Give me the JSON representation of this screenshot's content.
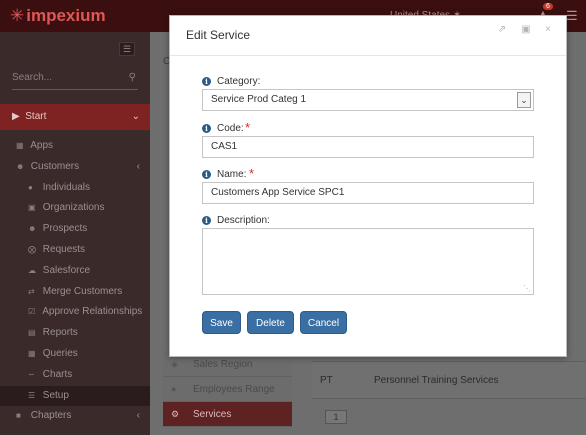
{
  "app": {
    "logo_text": "impexium",
    "logo_mark": "✳",
    "country": "United States ✶",
    "notification_count": "6"
  },
  "sidebar": {
    "search_placeholder": "Search...",
    "start_label": "Start",
    "items": [
      {
        "label": "Apps",
        "icon": "grid-icon",
        "level": 1
      },
      {
        "label": "Customers",
        "icon": "users-icon",
        "level": 1,
        "chevron": "‹"
      },
      {
        "label": "Individuals",
        "icon": "user-icon",
        "level": 2
      },
      {
        "label": "Organizations",
        "icon": "building-icon",
        "level": 2
      },
      {
        "label": "Prospects",
        "icon": "users-icon",
        "level": 2
      },
      {
        "label": "Requests",
        "icon": "request-icon",
        "level": 2
      },
      {
        "label": "Salesforce",
        "icon": "cloud-icon",
        "level": 2
      },
      {
        "label": "Merge Customers",
        "icon": "merge-icon",
        "level": 2
      },
      {
        "label": "Approve Relationships",
        "icon": "check-icon",
        "level": 2
      },
      {
        "label": "Reports",
        "icon": "chart-icon",
        "level": 2
      },
      {
        "label": "Queries",
        "icon": "table-icon",
        "level": 2
      },
      {
        "label": "Charts",
        "icon": "linechart-icon",
        "level": 2
      },
      {
        "label": "Setup",
        "icon": "list-icon",
        "level": 2,
        "active": true
      },
      {
        "label": "Chapters",
        "icon": "folder-icon",
        "level": 1,
        "chevron": "‹"
      }
    ]
  },
  "background": {
    "secondary_nav": [
      {
        "label": "Sales Region",
        "icon": "map-icon"
      },
      {
        "label": "Employees Range",
        "icon": "person-icon"
      },
      {
        "label": "Services",
        "icon": "gears-icon",
        "active": true
      }
    ],
    "grid_row": {
      "code": "PT",
      "name": "Personnel Training Services"
    },
    "pager_page": "1",
    "header_letters": "C"
  },
  "modal": {
    "title": "Edit Service",
    "fields": {
      "category": {
        "label": "Category:",
        "value": "Service Prod Categ 1",
        "required": false
      },
      "code": {
        "label": "Code:",
        "value": "CAS1",
        "required": true
      },
      "name": {
        "label": "Name:",
        "value": "Customers App Service SPC1",
        "required": true
      },
      "description": {
        "label": "Description:",
        "value": "",
        "required": false
      }
    },
    "info_glyph": "i",
    "required_glyph": "*",
    "buttons": {
      "save": "Save",
      "delete": "Delete",
      "cancel": "Cancel"
    }
  }
}
